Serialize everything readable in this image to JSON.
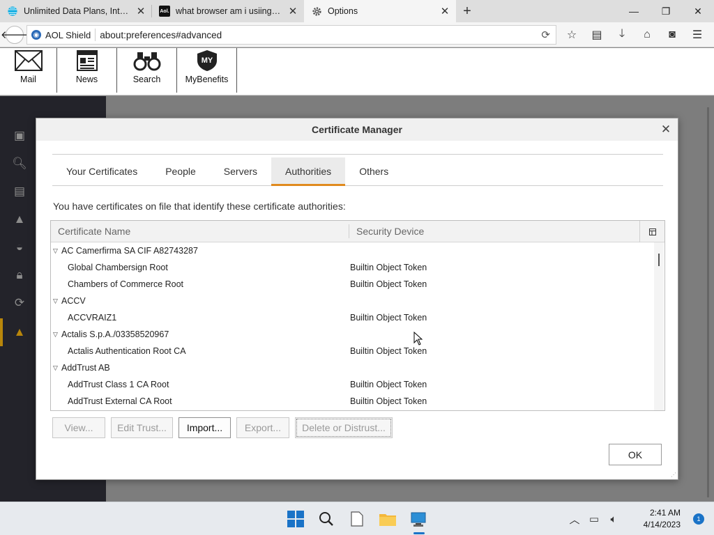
{
  "browser": {
    "tabs": [
      {
        "title": "Unlimited Data Plans, Inte…",
        "icon": "att-globe-icon",
        "active": false
      },
      {
        "title": "what browser am i usiing …",
        "icon": "aol-icon",
        "favicon_text": "Aol.",
        "active": false
      },
      {
        "title": "Options",
        "icon": "gear-icon",
        "active": true
      }
    ],
    "new_tab": "+",
    "window_controls": {
      "minimize": "—",
      "maximize": "❐",
      "close": "✕"
    },
    "shield_label": "AOL Shield",
    "url": "about:preferences#advanced"
  },
  "aol_toolbar": [
    {
      "label": "Mail",
      "icon": "mail-icon"
    },
    {
      "label": "News",
      "icon": "news-icon"
    },
    {
      "label": "Search",
      "icon": "binoculars-icon"
    },
    {
      "label": "MyBenefits",
      "icon": "mybenefits-shield-icon",
      "badge_text": "MY"
    }
  ],
  "dialog": {
    "title": "Certificate Manager",
    "tabs": [
      {
        "label": "Your Certificates",
        "active": false
      },
      {
        "label": "People",
        "active": false
      },
      {
        "label": "Servers",
        "active": false
      },
      {
        "label": "Authorities",
        "active": true
      },
      {
        "label": "Others",
        "active": false
      }
    ],
    "intro": "You have certificates on file that identify these certificate authorities:",
    "columns": {
      "name": "Certificate Name",
      "device": "Security Device"
    },
    "rows": [
      {
        "type": "group",
        "name": "AC Camerfirma SA CIF A82743287",
        "device": ""
      },
      {
        "type": "child",
        "name": "Global Chambersign Root",
        "device": "Builtin Object Token"
      },
      {
        "type": "child",
        "name": "Chambers of Commerce Root",
        "device": "Builtin Object Token"
      },
      {
        "type": "group",
        "name": "ACCV",
        "device": ""
      },
      {
        "type": "child",
        "name": "ACCVRAIZ1",
        "device": "Builtin Object Token"
      },
      {
        "type": "group",
        "name": "Actalis S.p.A./03358520967",
        "device": ""
      },
      {
        "type": "child",
        "name": "Actalis Authentication Root CA",
        "device": "Builtin Object Token"
      },
      {
        "type": "group",
        "name": "AddTrust AB",
        "device": ""
      },
      {
        "type": "child",
        "name": "AddTrust Class 1 CA Root",
        "device": "Builtin Object Token"
      },
      {
        "type": "child",
        "name": "AddTrust External CA Root",
        "device": "Builtin Object Token"
      }
    ],
    "buttons": {
      "view": "View...",
      "edit_trust": "Edit Trust...",
      "import": "Import...",
      "export": "Export...",
      "delete": "Delete or Distrust..."
    },
    "ok": "OK"
  },
  "taskbar": {
    "time": "2:41 AM",
    "date": "4/14/2023",
    "notification_count": "1"
  },
  "colors": {
    "accent_tab": "#e08a1e",
    "sidebar_bg": "#23232a",
    "sidebar_active": "#b8860b",
    "taskbar_accent": "#1a73c7"
  }
}
